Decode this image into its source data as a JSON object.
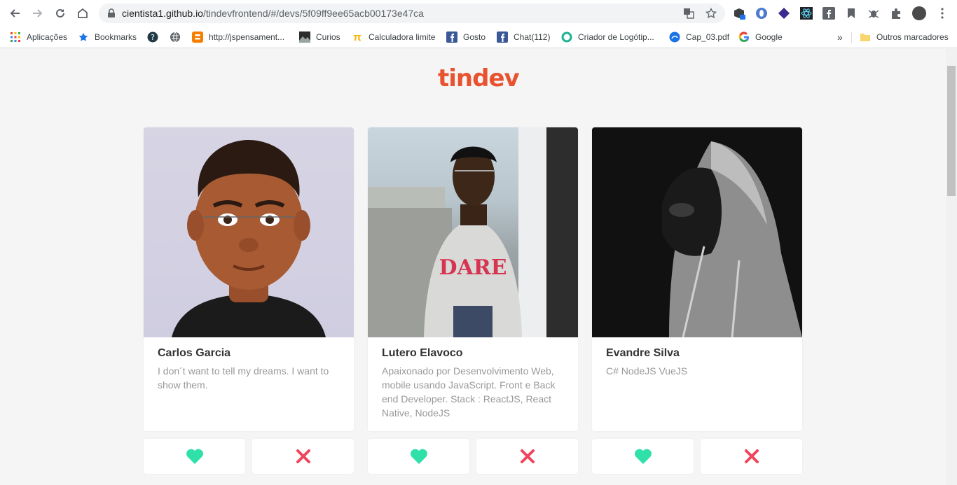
{
  "browser": {
    "url_host": "cientista1.github.io",
    "url_path": "/tindevfrontend/#/devs/5f09ff9ee65acb00173e47ca",
    "bookmarks": [
      {
        "label": "Aplicações",
        "icon": "apps-grid-icon"
      },
      {
        "label": "Bookmarks",
        "icon": "star-icon"
      },
      {
        "label": "",
        "icon": "help-icon"
      },
      {
        "label": "",
        "icon": "globe-icon"
      },
      {
        "label": "http://jspensament...",
        "icon": "blogger-icon"
      },
      {
        "label": "Curios",
        "icon": "image-icon"
      },
      {
        "label": "Calculadora limite",
        "icon": "pi-icon"
      },
      {
        "label": "Gosto",
        "icon": "facebook-icon"
      },
      {
        "label": "Chat(112)",
        "icon": "facebook-icon"
      },
      {
        "label": "Criador de Logótip...",
        "icon": "ring-icon"
      },
      {
        "label": "Cap_03.pdf",
        "icon": "pdf-icon"
      },
      {
        "label": "Google",
        "icon": "google-icon"
      }
    ],
    "overflow_label": "»",
    "other_bookmarks": "Outros marcadores"
  },
  "app": {
    "logo": "tindev"
  },
  "devs": [
    {
      "name": "Carlos Garcia",
      "bio": "I don´t want to tell my dreams. I want to show them."
    },
    {
      "name": "Lutero Elavoco",
      "bio": "Apaixonado por Desenvolvimento Web, mobile usando JavaScript. Front e Back end Developer. Stack : ReactJS, React Native, NodeJS"
    },
    {
      "name": "Evandre Silva",
      "bio": "C# NodeJS VueJS"
    }
  ],
  "colors": {
    "brand": "#e8522f",
    "like": "#2fe0a9",
    "dislike": "#f0455c"
  }
}
